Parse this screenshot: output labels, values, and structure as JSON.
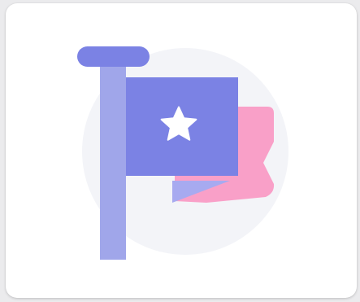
{
  "card": {
    "illustration": {
      "icon": "flag-with-star-icon",
      "colors": {
        "card_background": "#ffffff",
        "page_background": "#ebebed",
        "circle_background": "#f3f4f8",
        "pole": "#a0a6ea",
        "pole_cap": "#7b82e4",
        "flag_front": "#7b82e4",
        "flag_back": "#f9a0c8",
        "flag_fold": "#a7aaf0",
        "star": "#ffffff"
      }
    }
  }
}
